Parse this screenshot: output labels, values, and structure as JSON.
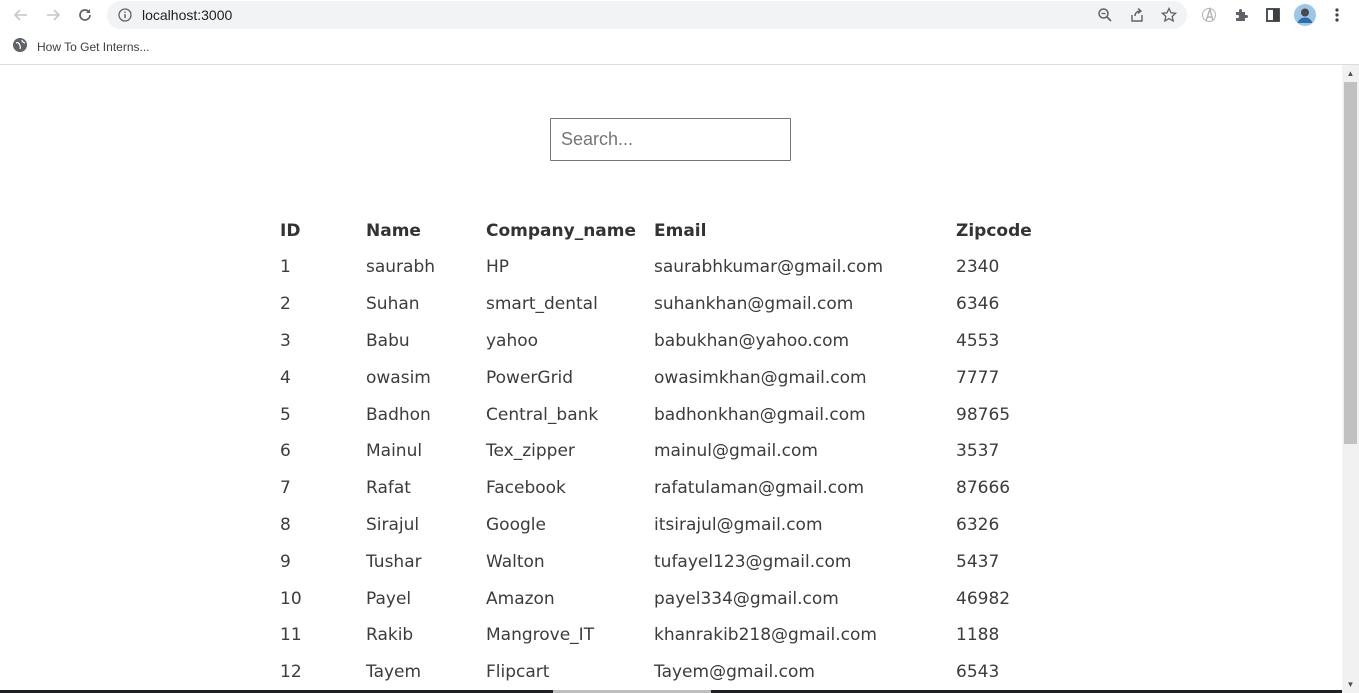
{
  "browser": {
    "url": "localhost:3000",
    "bookmark_label": "How To Get Interns..."
  },
  "search": {
    "placeholder": "Search...",
    "value": ""
  },
  "table": {
    "headers": {
      "id": "ID",
      "name": "Name",
      "company": "Company_name",
      "email": "Email",
      "zipcode": "Zipcode"
    },
    "rows": [
      {
        "id": "1",
        "name": "saurabh",
        "company": "HP",
        "email": "saurabhkumar@gmail.com",
        "zipcode": "2340"
      },
      {
        "id": "2",
        "name": "Suhan",
        "company": "smart_dental",
        "email": "suhankhan@gmail.com",
        "zipcode": "6346"
      },
      {
        "id": "3",
        "name": "Babu",
        "company": "yahoo",
        "email": "babukhan@yahoo.com",
        "zipcode": "4553"
      },
      {
        "id": "4",
        "name": "owasim",
        "company": "PowerGrid",
        "email": "owasimkhan@gmail.com",
        "zipcode": "7777"
      },
      {
        "id": "5",
        "name": "Badhon",
        "company": "Central_bank",
        "email": "badhonkhan@gmail.com",
        "zipcode": "98765"
      },
      {
        "id": "6",
        "name": "Mainul",
        "company": "Tex_zipper",
        "email": "mainul@gmail.com",
        "zipcode": "3537"
      },
      {
        "id": "7",
        "name": "Rafat",
        "company": "Facebook",
        "email": "rafatulaman@gmail.com",
        "zipcode": "87666"
      },
      {
        "id": "8",
        "name": "Sirajul",
        "company": "Google",
        "email": "itsirajul@gmail.com",
        "zipcode": "6326"
      },
      {
        "id": "9",
        "name": "Tushar",
        "company": "Walton",
        "email": "tufayel123@gmail.com",
        "zipcode": "5437"
      },
      {
        "id": "10",
        "name": "Payel",
        "company": "Amazon",
        "email": "payel334@gmail.com",
        "zipcode": "46982"
      },
      {
        "id": "11",
        "name": "Rakib",
        "company": "Mangrove_IT",
        "email": "khanrakib218@gmail.com",
        "zipcode": "1188"
      },
      {
        "id": "12",
        "name": "Tayem",
        "company": "Flipcart",
        "email": "Tayem@gmail.com",
        "zipcode": "6543"
      }
    ]
  }
}
